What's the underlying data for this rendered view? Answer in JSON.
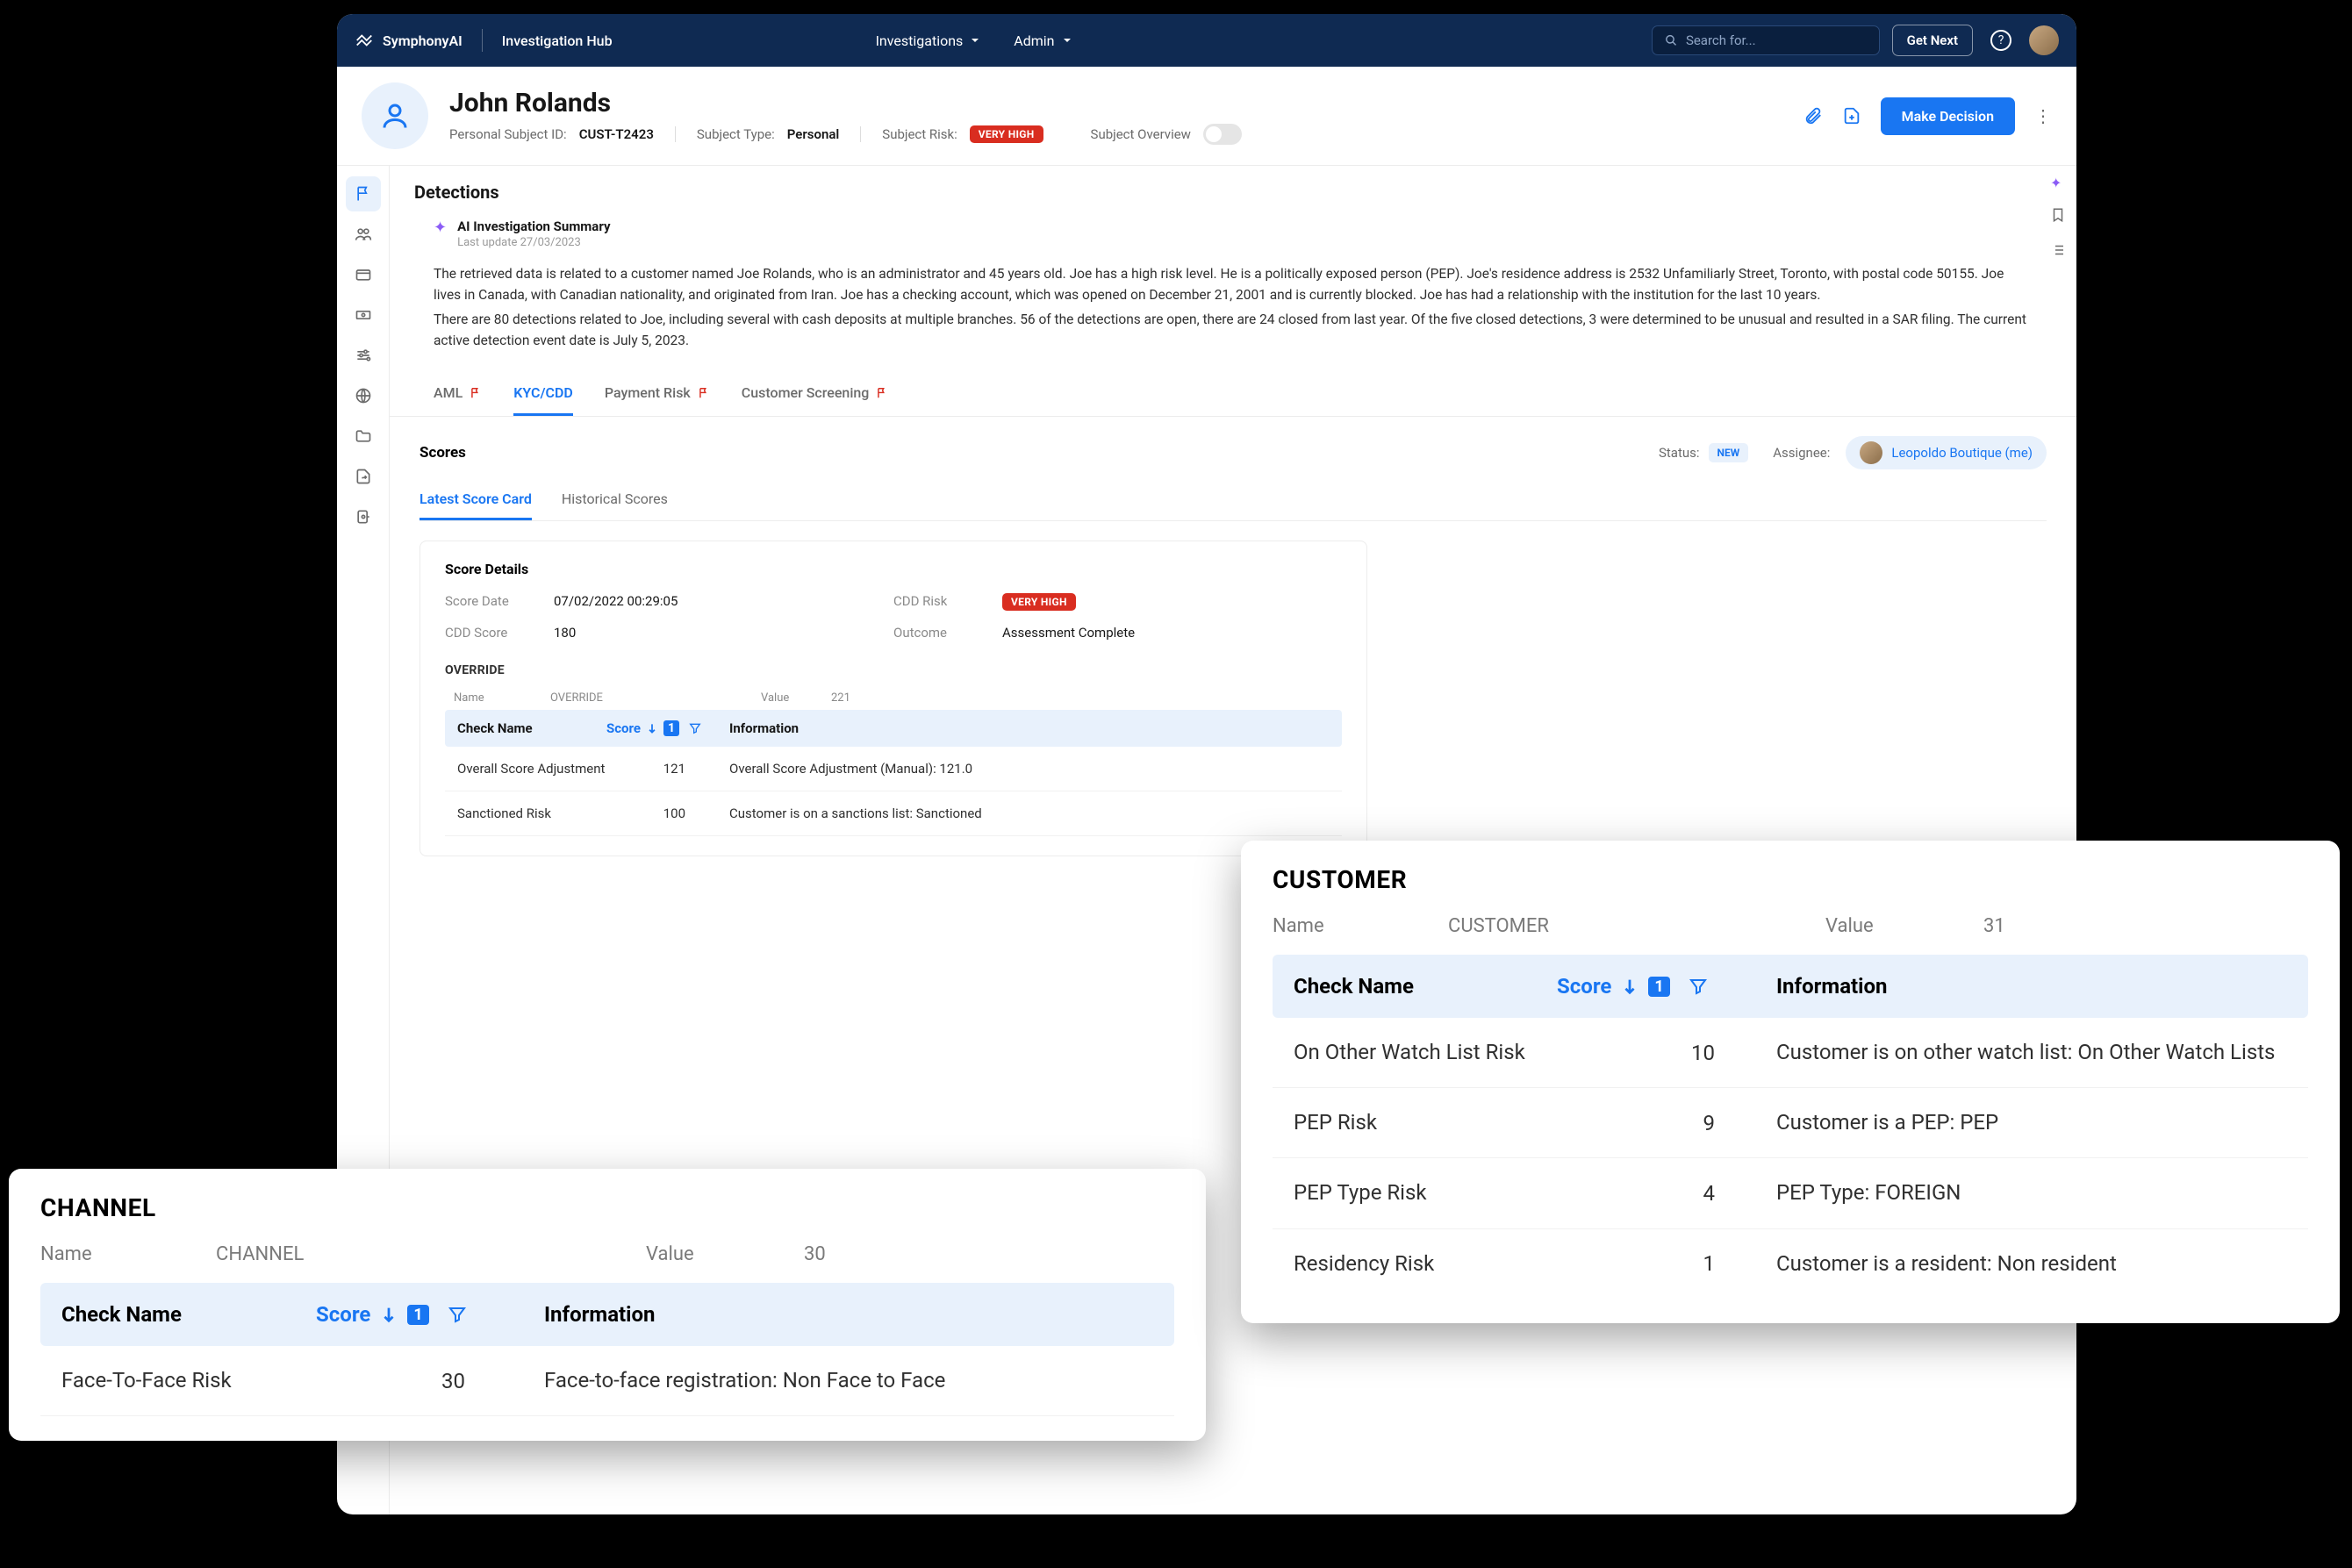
{
  "brand": "SymphonyAI",
  "hub": "Investigation Hub",
  "nav": {
    "investigations": "Investigations",
    "admin": "Admin"
  },
  "search": {
    "placeholder": "Search for..."
  },
  "getnext": "Get Next",
  "subject": {
    "name": "John Rolands",
    "id_label": "Personal Subject ID:",
    "id": "CUST-T2423",
    "type_label": "Subject Type:",
    "type": "Personal",
    "risk_label": "Subject Risk:",
    "risk": "VERY HIGH",
    "overview": "Subject Overview"
  },
  "actions": {
    "make_decision": "Make Decision"
  },
  "section_title": "Detections",
  "ai": {
    "title": "AI Investigation Summary",
    "updated": "Last update 27/03/2023",
    "p1": "The retrieved data is related to a customer named Joe Rolands, who is an administrator and 45 years old.  Joe has a high risk level. He is a politically exposed person (PEP). Joe's residence address is 2532 Unfamiliarly Street, Toronto, with postal code 50155. Joe lives in Canada, with  Canadian nationality, and originated from Iran.  Joe has a checking account, which was opened on December 21, 2001 and is currently blocked. Joe has had a relationship with the institution for the last 10 years.",
    "p2": "There are 80 detections related to Joe, including several with cash deposits at multiple branches. 56 of the detections are open, there are 24 closed from last year. Of the five closed detections, 3 were determined to be unusual and resulted in a SAR filing.  The current active detection event date is July 5, 2023."
  },
  "tabs": {
    "aml": "AML",
    "kyc": "KYC/CDD",
    "payment": "Payment Risk",
    "screening": "Customer Screening"
  },
  "scores": {
    "label": "Scores",
    "status_label": "Status:",
    "status": "NEW",
    "assignee_label": "Assignee:",
    "assignee": "Leopoldo Boutique (me)",
    "subtabs": {
      "latest": "Latest Score Card",
      "historical": "Historical Scores"
    },
    "details_title": "Score Details",
    "date_label": "Score Date",
    "date": "07/02/2022 00:29:05",
    "cdd_risk_label": "CDD Risk",
    "cdd_risk": "VERY HIGH",
    "cdd_score_label": "CDD Score",
    "cdd_score": "180",
    "outcome_label": "Outcome",
    "outcome": "Assessment Complete"
  },
  "override": {
    "title": "OVERRIDE",
    "name_label": "Name",
    "name_val": "OVERRIDE",
    "value_label": "Value",
    "value": "221",
    "cols": {
      "check": "Check Name",
      "score": "Score",
      "info": "Information"
    },
    "rows": [
      {
        "check": "Overall Score Adjustment",
        "score": "121",
        "info": "Overall Score Adjustment (Manual): 121.0"
      },
      {
        "check": "Sanctioned Risk",
        "score": "100",
        "info": "Customer is on a sanctions list: Sanctioned"
      }
    ]
  },
  "channel": {
    "title": "CHANNEL",
    "name_label": "Name",
    "name": "CHANNEL",
    "value_label": "Value",
    "value": "30",
    "cols": {
      "check": "Check Name",
      "score": "Score",
      "info": "Information"
    },
    "rows": [
      {
        "check": "Face-To-Face Risk",
        "score": "30",
        "info": "Face-to-face registration: Non Face to Face"
      }
    ]
  },
  "customer": {
    "title": "CUSTOMER",
    "name_label": "Name",
    "name": "CUSTOMER",
    "value_label": "Value",
    "value": "31",
    "cols": {
      "check": "Check Name",
      "score": "Score",
      "info": "Information"
    },
    "rows": [
      {
        "check": "On Other Watch List Risk",
        "score": "10",
        "info": "Customer is on other watch list: On Other Watch Lists"
      },
      {
        "check": "PEP Risk",
        "score": "9",
        "info": "Customer is a PEP: PEP"
      },
      {
        "check": "PEP Type Risk",
        "score": "4",
        "info": "PEP Type: FOREIGN"
      },
      {
        "check": "Residency Risk",
        "score": "1",
        "info": "Customer is a resident: Non resident"
      }
    ]
  }
}
